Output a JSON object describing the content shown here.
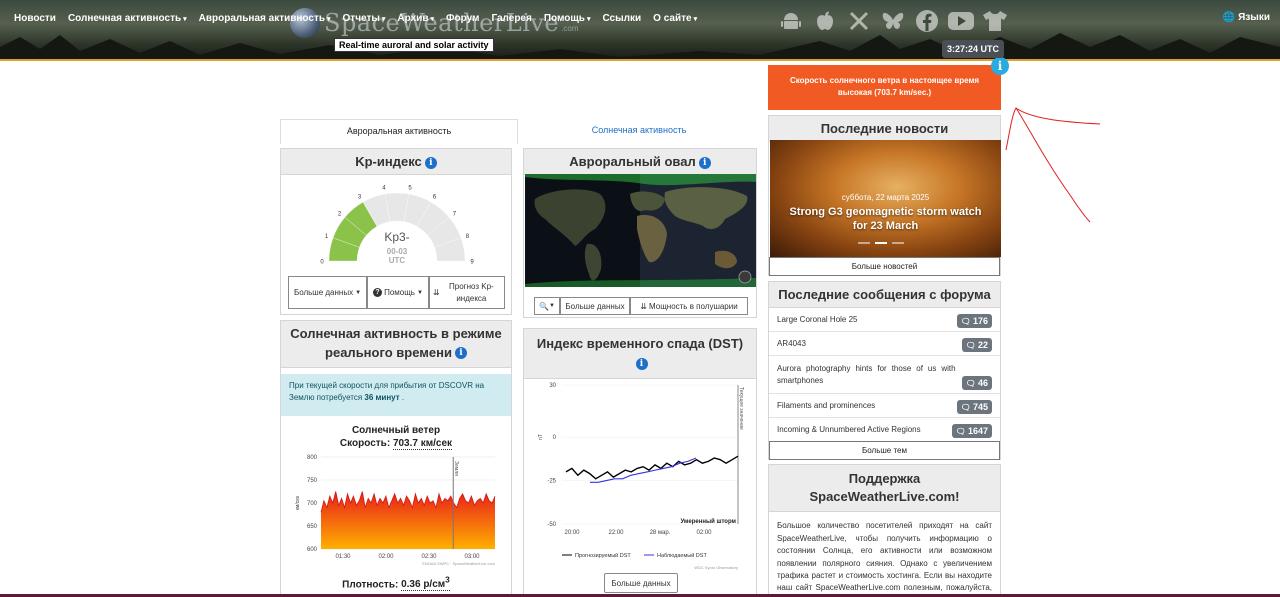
{
  "nav": {
    "items": [
      {
        "label": "Новости",
        "caret": false
      },
      {
        "label": "Солнечная активность",
        "caret": true
      },
      {
        "label": "Авроральная активность",
        "caret": true
      },
      {
        "label": "Отчеты",
        "caret": true
      },
      {
        "label": "Архив",
        "caret": true
      },
      {
        "label": "Форум",
        "caret": false
      },
      {
        "label": "Галерея",
        "caret": false
      },
      {
        "label": "Помощь",
        "caret": true
      },
      {
        "label": "Ссылки",
        "caret": false
      },
      {
        "label": "О сайте",
        "caret": true
      }
    ],
    "logo_text": "SpaceWeatherLive",
    "logo_com": ".com",
    "tagline": "Real-time auroral and solar activity",
    "language": "Языки",
    "clock": "3:27:24 UTC",
    "social_icons": [
      "android-icon",
      "apple-icon",
      "x-icon",
      "bluesky-icon",
      "facebook-icon",
      "youtube-icon",
      "tshirt-icon"
    ]
  },
  "alert": {
    "text": "Скорость солнечного ветра в настоящее время высокая (703.7 km/sec.)"
  },
  "tabs": {
    "auroral": "Авроральная активность",
    "solar": "Солнечная активность"
  },
  "kp": {
    "title": "Kp-индекс",
    "value": "Kp3-",
    "time": "00-03",
    "tz": "UTC",
    "level": 3,
    "scale": [
      "0",
      "1",
      "2",
      "3",
      "4",
      "5",
      "6",
      "7",
      "8",
      "9"
    ],
    "btn_more": "Больше данных",
    "btn_help": "Помощь",
    "btn_forecast": "Прогноз Kp-индекса",
    "color_active": "#8bc34a"
  },
  "realtime": {
    "title": "Солнечная активность в режиме реального времени",
    "info_pre": "При текущей скорости для прибытия от DSCOVR на Землю потребуется ",
    "info_bold": "36 минут",
    "info_post": " .",
    "wind_label": "Солнечный ветер",
    "speed_label": "Скорость:",
    "speed_value": "703.7 км/сек",
    "density_label": "Плотность:",
    "density_value": "0.36 р/см",
    "density_sup": "3"
  },
  "oval": {
    "title": "Авроральный овал",
    "btn_more": "Больше данных",
    "btn_power": "Мощность в полушарии"
  },
  "dst": {
    "title": "Индекс временного спада (DST)",
    "btn_more": "Больше данных"
  },
  "news": {
    "title": "Последние новости",
    "date": "суббота, 22 марта 2025",
    "headline": "Strong G3 geomagnetic storm watch for 23 March",
    "more": "Больше новостей"
  },
  "forum": {
    "title": "Последние сообщения с форума",
    "rows": [
      {
        "label": "Large Coronal Hole 25",
        "count": "176"
      },
      {
        "label": "AR4043",
        "count": "22"
      },
      {
        "label": "Aurora photography hints for those of us with smartphones",
        "count": "46"
      },
      {
        "label": "Filaments and prominences",
        "count": "745"
      },
      {
        "label": "Incoming & Unnumbered Active Regions",
        "count": "1647"
      }
    ],
    "more": "Больше тем"
  },
  "support": {
    "title": "Поддержка SpaceWeatherLive.com!",
    "text": "Большое количество посетителей приходят на сайт SpaceWeatherLive, чтобы получить информацию о состоянии Солнца, его активности или возможном появлении полярного сияния. Однако с увеличением трафика растет и стоимость хостинга. Если вы находите наш сайт SpaceWeatherLive.com полезным, пожалуйста, поддержите с пожертвованием, но это единственная и"
  },
  "chart_data": [
    {
      "type": "area",
      "title": "Солнечный ветер",
      "xlabel": "",
      "ylabel": "км/сек",
      "x_ticks": [
        "01:30",
        "02:00",
        "02:30",
        "03:00"
      ],
      "y_ticks": [
        600,
        650,
        700,
        750,
        800
      ],
      "ylim": [
        600,
        800
      ],
      "marker_label": "Земля",
      "credit": "©NOAA SWPC · SpaceWeatherLive.com",
      "values": [
        680,
        705,
        690,
        715,
        700,
        725,
        695,
        710,
        690,
        720,
        700,
        715,
        695,
        705,
        725,
        690,
        710,
        700,
        720,
        695,
        710,
        700,
        715,
        690,
        705,
        720,
        700,
        710,
        695,
        715,
        705,
        690,
        720,
        700,
        710,
        695,
        715,
        700,
        705,
        690,
        720,
        700,
        710,
        705,
        715,
        700,
        690,
        710,
        720,
        705,
        700,
        715,
        695,
        705,
        710,
        700,
        720,
        705,
        700,
        715
      ]
    },
    {
      "type": "line",
      "title": "Индекс временного спада (DST)",
      "ylabel": "nT",
      "ylim": [
        -50,
        30
      ],
      "y_ticks": [
        30,
        0,
        -25,
        -50
      ],
      "x_ticks": [
        "20:00",
        "22:00",
        "28 мар.",
        "02:00"
      ],
      "current_time_label": "Текущее значение",
      "storm_label": "Умеренный шторм",
      "credit": "WDC Kyoto Observatory",
      "series": [
        {
          "name": "Прогнозируемый DST",
          "color": "#000000",
          "values": [
            -20,
            -18,
            -22,
            -19,
            -21,
            -24,
            -22,
            -20,
            -23,
            -21,
            -19,
            -20,
            -18,
            -17,
            -19,
            -16,
            -18,
            -15,
            -17,
            -14,
            -16,
            -15,
            -13,
            -15,
            -14,
            -12,
            -13,
            -15,
            -13,
            -11
          ]
        },
        {
          "name": "Наблюдаемый DST",
          "color": "#3333dd",
          "values": [
            -26,
            -26,
            -25,
            -24,
            -24,
            -22,
            -21,
            -20,
            -19,
            -18,
            -17,
            -15,
            -14,
            -12
          ]
        }
      ]
    }
  ]
}
